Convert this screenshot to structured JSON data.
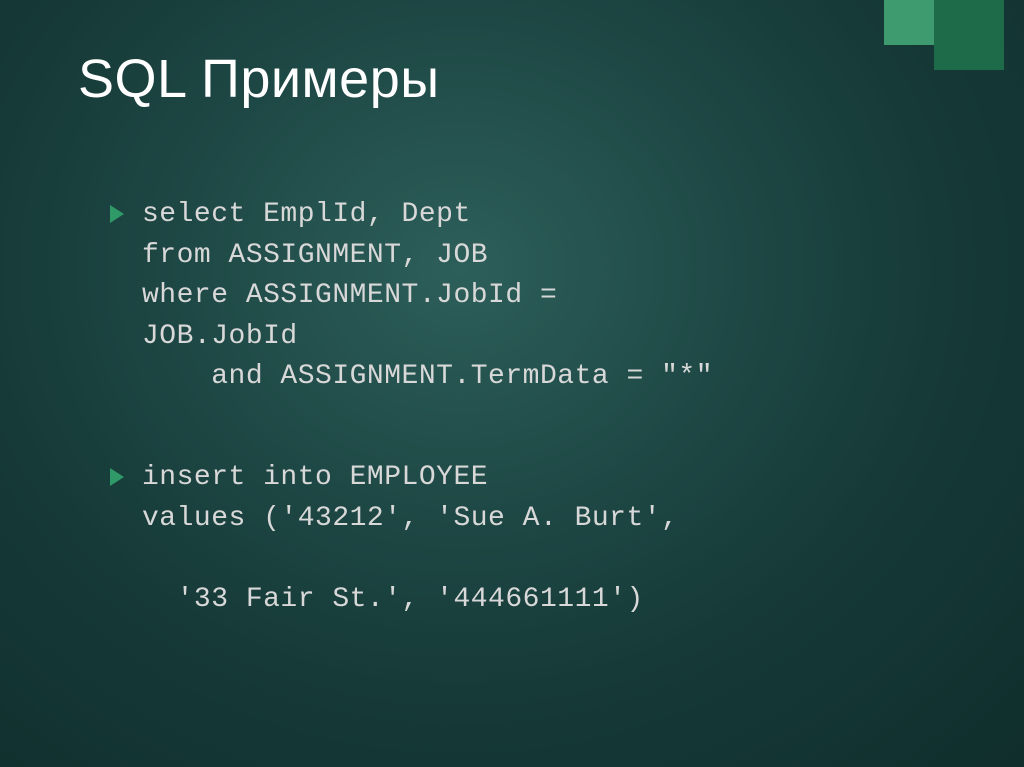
{
  "slide": {
    "title": "SQL Примеры",
    "accent_colors": {
      "light": "#3d9b6f",
      "dark": "#1e6b4a"
    },
    "bullets": [
      {
        "code": "select EmplId, Dept\nfrom ASSIGNMENT, JOB\nwhere ASSIGNMENT.JobId =\nJOB.JobId\n    and ASSIGNMENT.TermData = \"*\""
      },
      {
        "code": "insert into EMPLOYEE\nvalues ('43212', 'Sue A. Burt',\n\n  '33 Fair St.', '444661111')"
      }
    ]
  }
}
